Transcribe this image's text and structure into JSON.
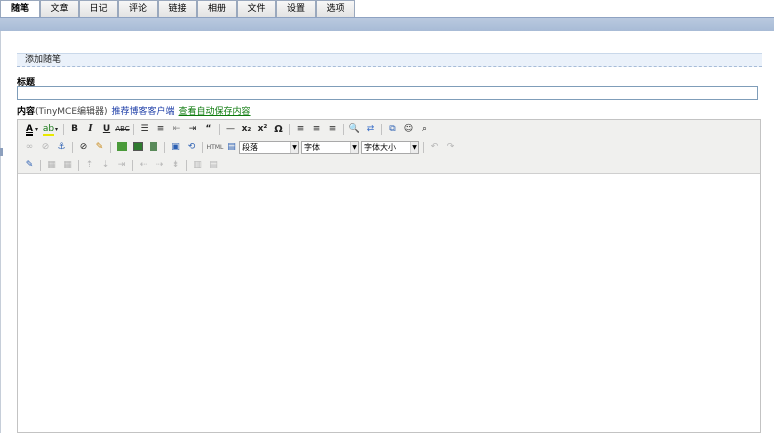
{
  "tabs": [
    "随笔",
    "文章",
    "日记",
    "评论",
    "链接",
    "相册",
    "文件",
    "设置",
    "选项"
  ],
  "active_tab": "随笔",
  "section_title": "添加随笔",
  "title_field": {
    "label": "标题",
    "value": ""
  },
  "content": {
    "label": "内容",
    "editor_hint": "(TinyMCE编辑器)",
    "recommend_link": "推荐博客客户端",
    "autosave_link": "查看自动保存内容"
  },
  "toolbar": {
    "format_select": "段落",
    "font_select": "字体",
    "size_select": "字体大小"
  }
}
